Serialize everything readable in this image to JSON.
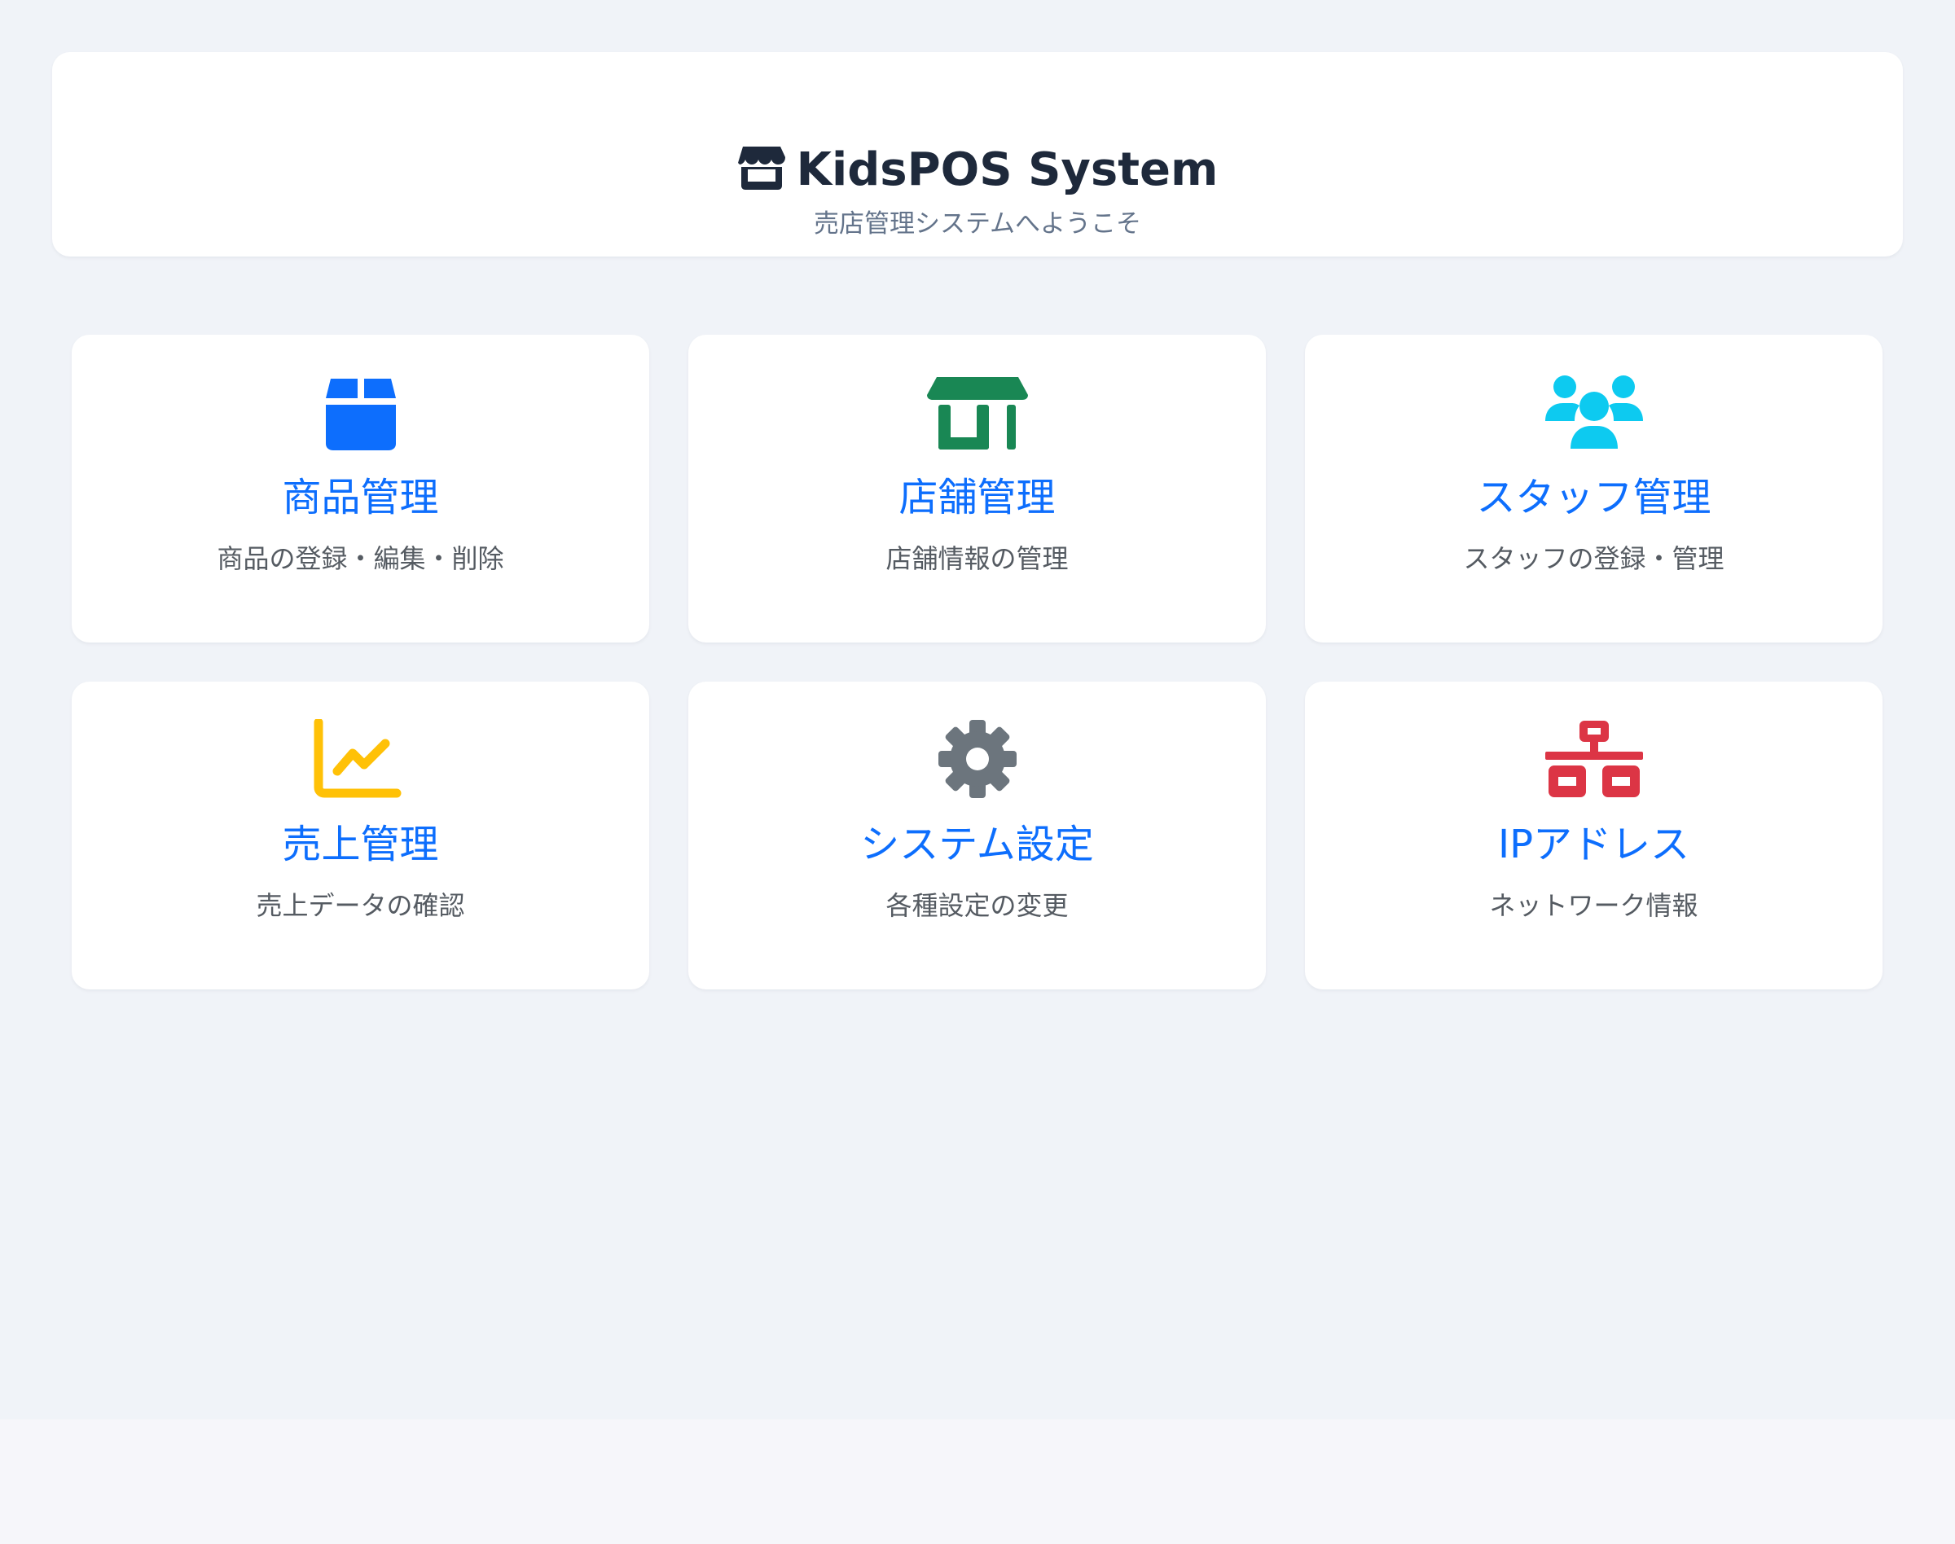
{
  "header": {
    "icon": "store-icon",
    "title": "KidsPOS System",
    "subtitle": "売店管理システムへようこそ"
  },
  "menu": [
    {
      "key": "products",
      "icon": "box-icon",
      "icon_color": "#0d6efd",
      "title": "商品管理",
      "description": "商品の登録・編集・削除"
    },
    {
      "key": "stores",
      "icon": "shop-icon",
      "icon_color": "#198754",
      "title": "店舗管理",
      "description": "店舗情報の管理"
    },
    {
      "key": "staff",
      "icon": "users-icon",
      "icon_color": "#0dcaf0",
      "title": "スタッフ管理",
      "description": "スタッフの登録・管理"
    },
    {
      "key": "sales",
      "icon": "chart-line-icon",
      "icon_color": "#ffc107",
      "title": "売上管理",
      "description": "売上データの確認"
    },
    {
      "key": "settings",
      "icon": "gear-icon",
      "icon_color": "#6c757d",
      "title": "システム設定",
      "description": "各種設定の変更"
    },
    {
      "key": "ip-address",
      "icon": "network-icon",
      "icon_color": "#dc3545",
      "title": "IPアドレス",
      "description": "ネットワーク情報"
    }
  ],
  "colors": {
    "background": "#f0f3f8",
    "card": "#ffffff",
    "accent": "#0d6efd",
    "title_text": "#1e293b",
    "subtitle_text": "#64748b"
  }
}
